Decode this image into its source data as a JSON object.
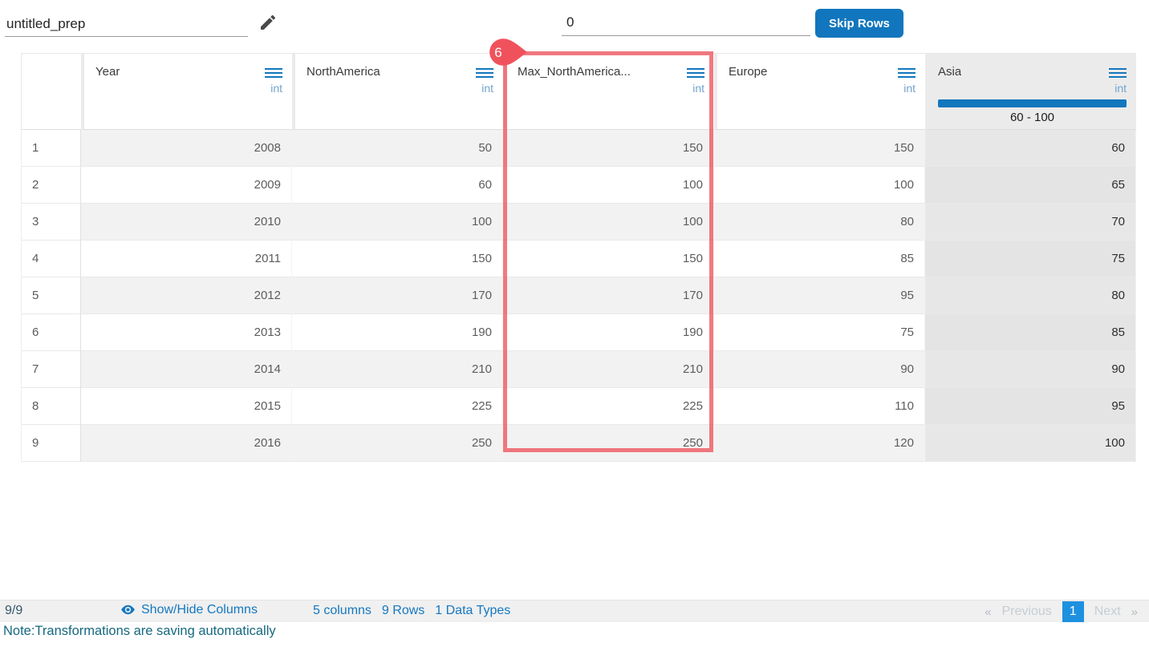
{
  "title_bar": {
    "prep_name": "untitled_prep",
    "skip_rows_value": "0",
    "skip_rows_label": "Skip Rows"
  },
  "annotation": {
    "step_badge": "6",
    "highlighted_column": "Max_NorthAmerica..."
  },
  "table": {
    "columns": [
      {
        "name": "",
        "type": "",
        "highlighted": false
      },
      {
        "name": "Year",
        "type": "int",
        "highlighted": false
      },
      {
        "name": "NorthAmerica",
        "type": "int",
        "highlighted": false
      },
      {
        "name": "Max_NorthAmerica...",
        "type": "int",
        "highlighted": false
      },
      {
        "name": "Europe",
        "type": "int",
        "highlighted": false
      },
      {
        "name": "Asia",
        "type": "int",
        "highlighted": true,
        "range_label": "60 - 100"
      }
    ],
    "rows": [
      {
        "n": "1",
        "cells": [
          "2008",
          "50",
          "150",
          "150",
          "60"
        ]
      },
      {
        "n": "2",
        "cells": [
          "2009",
          "60",
          "100",
          "100",
          "65"
        ]
      },
      {
        "n": "3",
        "cells": [
          "2010",
          "100",
          "100",
          "80",
          "70"
        ]
      },
      {
        "n": "4",
        "cells": [
          "2011",
          "150",
          "150",
          "85",
          "75"
        ]
      },
      {
        "n": "5",
        "cells": [
          "2012",
          "170",
          "170",
          "95",
          "80"
        ]
      },
      {
        "n": "6",
        "cells": [
          "2013",
          "190",
          "190",
          "75",
          "85"
        ]
      },
      {
        "n": "7",
        "cells": [
          "2014",
          "210",
          "210",
          "90",
          "90"
        ]
      },
      {
        "n": "8",
        "cells": [
          "2015",
          "225",
          "225",
          "110",
          "95"
        ]
      },
      {
        "n": "9",
        "cells": [
          "2016",
          "250",
          "250",
          "120",
          "100"
        ]
      }
    ]
  },
  "footer": {
    "row_count": "9/9",
    "show_hide_label": "Show/Hide Columns",
    "columns_label": "5 columns",
    "rows_label": "9 Rows",
    "types_label": "1 Data Types",
    "pagination": {
      "prev_symbol": "«",
      "prev_label": "Previous",
      "active_page": "1",
      "next_label": "Next",
      "next_symbol": "»"
    }
  },
  "note_text": "Note:Transformations are saving automatically",
  "colors": {
    "accent_blue": "#1377bd",
    "active_page_blue": "#1e90e0",
    "annotation_red": "#f0525c",
    "note_teal": "#15687f",
    "stripe_gray": "#f2f2f2",
    "asia_cell_gray": "#e4e4e4"
  }
}
